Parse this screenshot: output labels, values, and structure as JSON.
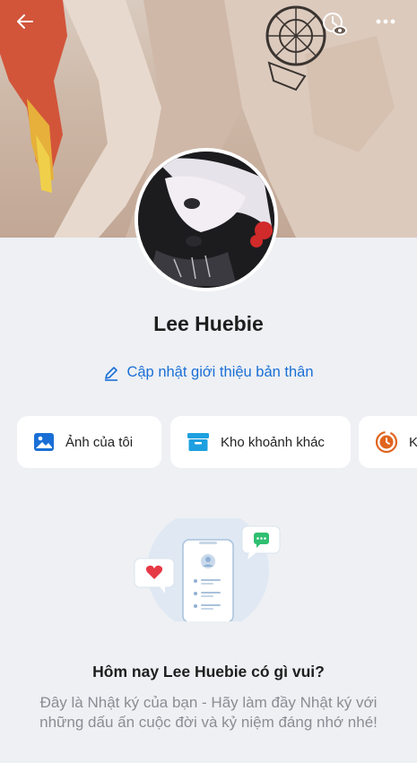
{
  "profile": {
    "name": "Lee Huebie",
    "update_intro_label": "Cập nhật giới thiệu bản thân"
  },
  "shortcuts": [
    {
      "label": "Ảnh của tôi",
      "icon": "photo-icon"
    },
    {
      "label": "Kho khoảnh khác",
      "icon": "archive-box-icon"
    },
    {
      "label": "K",
      "icon": "clock-history-icon"
    }
  ],
  "empty_state": {
    "title": "Hôm nay Lee Huebie có gì vui?",
    "description": "Đây là Nhật ký của bạn - Hãy làm đầy Nhật ký với những dấu ấn cuộc đời và kỷ niệm đáng nhớ nhé!"
  },
  "header": {
    "back_icon": "back-arrow-icon",
    "visibility_icon": "profile-visibility-icon",
    "more_icon": "more-dots-icon"
  },
  "colors": {
    "accent": "#1a6fd6",
    "background": "#eef0f4",
    "archive_icon": "#1ea0e0",
    "clock_icon": "#e0651e"
  }
}
